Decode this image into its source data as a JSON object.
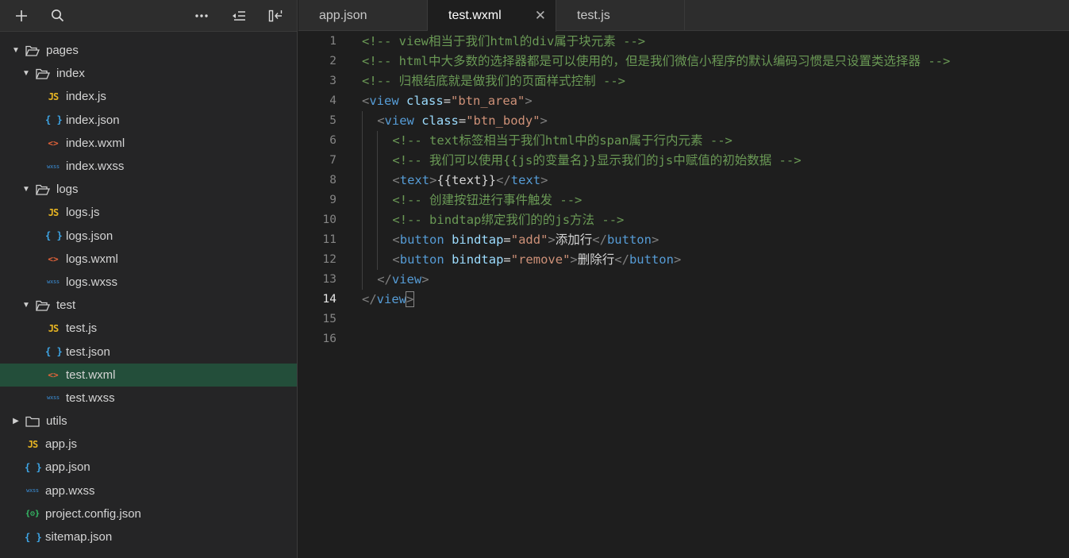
{
  "toolbar": {
    "icons": [
      "add-icon",
      "search-icon",
      "more-icon",
      "collapse-all-icon",
      "split-panel-icon"
    ]
  },
  "tree": [
    {
      "kind": "folder",
      "depth": 0,
      "open": true,
      "label": "pages"
    },
    {
      "kind": "folder",
      "depth": 1,
      "open": true,
      "label": "index"
    },
    {
      "kind": "file",
      "depth": 2,
      "type": "js",
      "label": "index.js"
    },
    {
      "kind": "file",
      "depth": 2,
      "type": "json",
      "label": "index.json"
    },
    {
      "kind": "file",
      "depth": 2,
      "type": "wxml",
      "label": "index.wxml"
    },
    {
      "kind": "file",
      "depth": 2,
      "type": "wxss",
      "label": "index.wxss"
    },
    {
      "kind": "folder",
      "depth": 1,
      "open": true,
      "label": "logs"
    },
    {
      "kind": "file",
      "depth": 2,
      "type": "js",
      "label": "logs.js"
    },
    {
      "kind": "file",
      "depth": 2,
      "type": "json",
      "label": "logs.json"
    },
    {
      "kind": "file",
      "depth": 2,
      "type": "wxml",
      "label": "logs.wxml"
    },
    {
      "kind": "file",
      "depth": 2,
      "type": "wxss",
      "label": "logs.wxss"
    },
    {
      "kind": "folder",
      "depth": 1,
      "open": true,
      "label": "test"
    },
    {
      "kind": "file",
      "depth": 2,
      "type": "js",
      "label": "test.js"
    },
    {
      "kind": "file",
      "depth": 2,
      "type": "json",
      "label": "test.json"
    },
    {
      "kind": "file",
      "depth": 2,
      "type": "wxml",
      "label": "test.wxml",
      "selected": true
    },
    {
      "kind": "file",
      "depth": 2,
      "type": "wxss",
      "label": "test.wxss"
    },
    {
      "kind": "folder",
      "depth": 0,
      "open": false,
      "label": "utils"
    },
    {
      "kind": "file",
      "depth": 0,
      "type": "js",
      "label": "app.js"
    },
    {
      "kind": "file",
      "depth": 0,
      "type": "json",
      "label": "app.json"
    },
    {
      "kind": "file",
      "depth": 0,
      "type": "wxss",
      "label": "app.wxss"
    },
    {
      "kind": "file",
      "depth": 0,
      "type": "conf",
      "label": "project.config.json"
    },
    {
      "kind": "file",
      "depth": 0,
      "type": "json",
      "label": "sitemap.json"
    }
  ],
  "icon_glyphs": {
    "js": "JS",
    "json": "{ }",
    "wxml": "<>",
    "wxss": "wxss",
    "conf": "{⚙}"
  },
  "tabs": [
    {
      "label": "app.json",
      "active": false
    },
    {
      "label": "test.wxml",
      "active": true,
      "close": "✕"
    },
    {
      "label": "test.js",
      "active": false
    }
  ],
  "editor": {
    "current_line": 14,
    "lines": [
      {
        "n": "1",
        "indent": 0,
        "tokens": [
          [
            "c-comment",
            "<!-- view相当于我们html的div属于块元素 -->"
          ]
        ]
      },
      {
        "n": "2",
        "indent": 0,
        "tokens": [
          [
            "c-comment",
            "<!-- html中大多数的选择器都是可以使用的，但是我们微信小程序的默认编码习惯是只设置类选择器 -->"
          ]
        ]
      },
      {
        "n": "3",
        "indent": 0,
        "tokens": [
          [
            "c-comment",
            "<!-- 归根结底就是做我们的页面样式控制 -->"
          ]
        ]
      },
      {
        "n": "4",
        "indent": 0,
        "tokens": [
          [
            "c-punc",
            "<"
          ],
          [
            "c-tag",
            "view"
          ],
          [
            "c-text",
            " "
          ],
          [
            "c-attr",
            "class"
          ],
          [
            "c-text",
            "="
          ],
          [
            "c-str",
            "\"btn_area\""
          ],
          [
            "c-punc",
            ">"
          ]
        ]
      },
      {
        "n": "5",
        "indent": 1,
        "tokens": [
          [
            "c-punc",
            "<"
          ],
          [
            "c-tag",
            "view"
          ],
          [
            "c-text",
            " "
          ],
          [
            "c-attr",
            "class"
          ],
          [
            "c-text",
            "="
          ],
          [
            "c-str",
            "\"btn_body\""
          ],
          [
            "c-punc",
            ">"
          ]
        ]
      },
      {
        "n": "6",
        "indent": 2,
        "tokens": [
          [
            "c-comment",
            "<!-- text标签相当于我们html中的span属于行内元素 -->"
          ]
        ]
      },
      {
        "n": "7",
        "indent": 2,
        "tokens": [
          [
            "c-comment",
            "<!-- 我们可以使用{{js的变量名}}显示我们的js中赋值的初始数据 -->"
          ]
        ]
      },
      {
        "n": "8",
        "indent": 2,
        "tokens": [
          [
            "c-punc",
            "<"
          ],
          [
            "c-tag",
            "text"
          ],
          [
            "c-punc",
            ">"
          ],
          [
            "c-text",
            "{{text}}"
          ],
          [
            "c-punc",
            "</"
          ],
          [
            "c-tag",
            "text"
          ],
          [
            "c-punc",
            ">"
          ]
        ]
      },
      {
        "n": "9",
        "indent": 2,
        "tokens": [
          [
            "c-comment",
            "<!-- 创建按钮进行事件触发 -->"
          ]
        ]
      },
      {
        "n": "10",
        "indent": 2,
        "tokens": [
          [
            "c-comment",
            "<!-- bindtap绑定我们的的js方法 -->"
          ]
        ]
      },
      {
        "n": "11",
        "indent": 2,
        "tokens": [
          [
            "c-punc",
            "<"
          ],
          [
            "c-tag",
            "button"
          ],
          [
            "c-text",
            " "
          ],
          [
            "c-attr",
            "bindtap"
          ],
          [
            "c-text",
            "="
          ],
          [
            "c-str",
            "\"add\""
          ],
          [
            "c-punc",
            ">"
          ],
          [
            "c-text",
            "添加行"
          ],
          [
            "c-punc",
            "</"
          ],
          [
            "c-tag",
            "button"
          ],
          [
            "c-punc",
            ">"
          ]
        ]
      },
      {
        "n": "12",
        "indent": 2,
        "tokens": [
          [
            "c-punc",
            "<"
          ],
          [
            "c-tag",
            "button"
          ],
          [
            "c-text",
            " "
          ],
          [
            "c-attr",
            "bindtap"
          ],
          [
            "c-text",
            "="
          ],
          [
            "c-str",
            "\"remove\""
          ],
          [
            "c-punc",
            ">"
          ],
          [
            "c-text",
            "删除行"
          ],
          [
            "c-punc",
            "</"
          ],
          [
            "c-tag",
            "button"
          ],
          [
            "c-punc",
            ">"
          ]
        ]
      },
      {
        "n": "13",
        "indent": 1,
        "tokens": [
          [
            "c-punc",
            "</"
          ],
          [
            "c-tag",
            "view"
          ],
          [
            "c-punc",
            ">"
          ]
        ]
      },
      {
        "n": "14",
        "indent": 0,
        "tokens": [
          [
            "c-punc",
            "</"
          ],
          [
            "c-tag",
            "view"
          ],
          [
            "c-punc bracket-match",
            ">"
          ]
        ]
      },
      {
        "n": "15",
        "indent": 0,
        "tokens": []
      },
      {
        "n": "16",
        "indent": 0,
        "tokens": []
      }
    ]
  }
}
